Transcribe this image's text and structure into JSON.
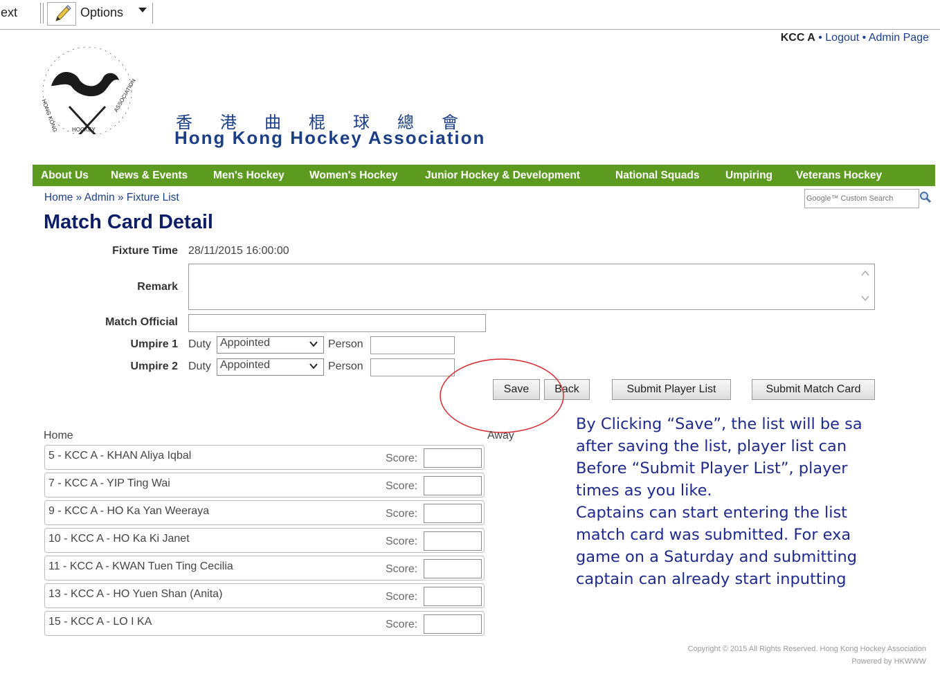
{
  "toolbar": {
    "next_label": "Next",
    "options_label": "Options"
  },
  "account": {
    "team": "KCC A",
    "sep": " • ",
    "logout": "Logout",
    "admin": "Admin Page"
  },
  "org": {
    "name_cn": "香港曲棍球總會",
    "name_en": "Hong Kong Hockey Association"
  },
  "nav": [
    "About Us",
    "News & Events",
    "Men's Hockey",
    "Women's Hockey",
    "Junior Hockey & Development",
    "National Squads",
    "Umpiring",
    "Veterans Hockey"
  ],
  "breadcrumb": {
    "home": "Home",
    "sep": " » ",
    "admin": "Admin",
    "current": "Fixture List"
  },
  "search": {
    "placeholder": "Google™ Custom Search"
  },
  "page_title": "Match Card Detail",
  "form": {
    "fixture_time_label": "Fixture Time",
    "fixture_time_value": "28/11/2015 16:00:00",
    "remark_label": "Remark",
    "official_label": "Match Official",
    "umpire1_label": "Umpire 1",
    "umpire2_label": "Umpire 2",
    "duty_label": "Duty",
    "person_label": "Person",
    "duty_value": "Appointed"
  },
  "buttons": {
    "save": "Save",
    "back": "Back",
    "submit_players": "Submit Player List",
    "submit_card": "Submit Match Card"
  },
  "columns": {
    "home": "Home",
    "away": "Away"
  },
  "score_label": "Score:",
  "players": [
    "5 - KCC A - KHAN Aliya Iqbal",
    "7 - KCC A - YIP Ting Wai",
    "9 - KCC A - HO Ka Yan Weeraya",
    "10 - KCC A - HO Ka Ki Janet",
    "11 - KCC A - KWAN Tuen Ting Cecilia",
    "13 - KCC A - HO Yuen Shan (Anita)",
    "15 - KCC A - LO I KA"
  ],
  "annotation": [
    "By Clicking “Save”, the list will be sa",
    "after saving the list, player list can",
    "Before “Submit Player List”, player",
    "times as you like.",
    "Captains can start entering the list",
    "match card was submitted. For exa",
    "game on a Saturday and submitting",
    "captain can already start inputting"
  ],
  "footer": {
    "copyright": "Copyright © 2015 All Rights Reserved. Hong Kong Hockey Association",
    "powered": "Powered by HKWWW"
  },
  "colors": {
    "nav_green": "#5d9b20",
    "title_navy": "#0d1e66",
    "link_blue": "#1b3e86",
    "annotation_blue": "#1e2a8c",
    "highlight_red": "#d9282f"
  }
}
